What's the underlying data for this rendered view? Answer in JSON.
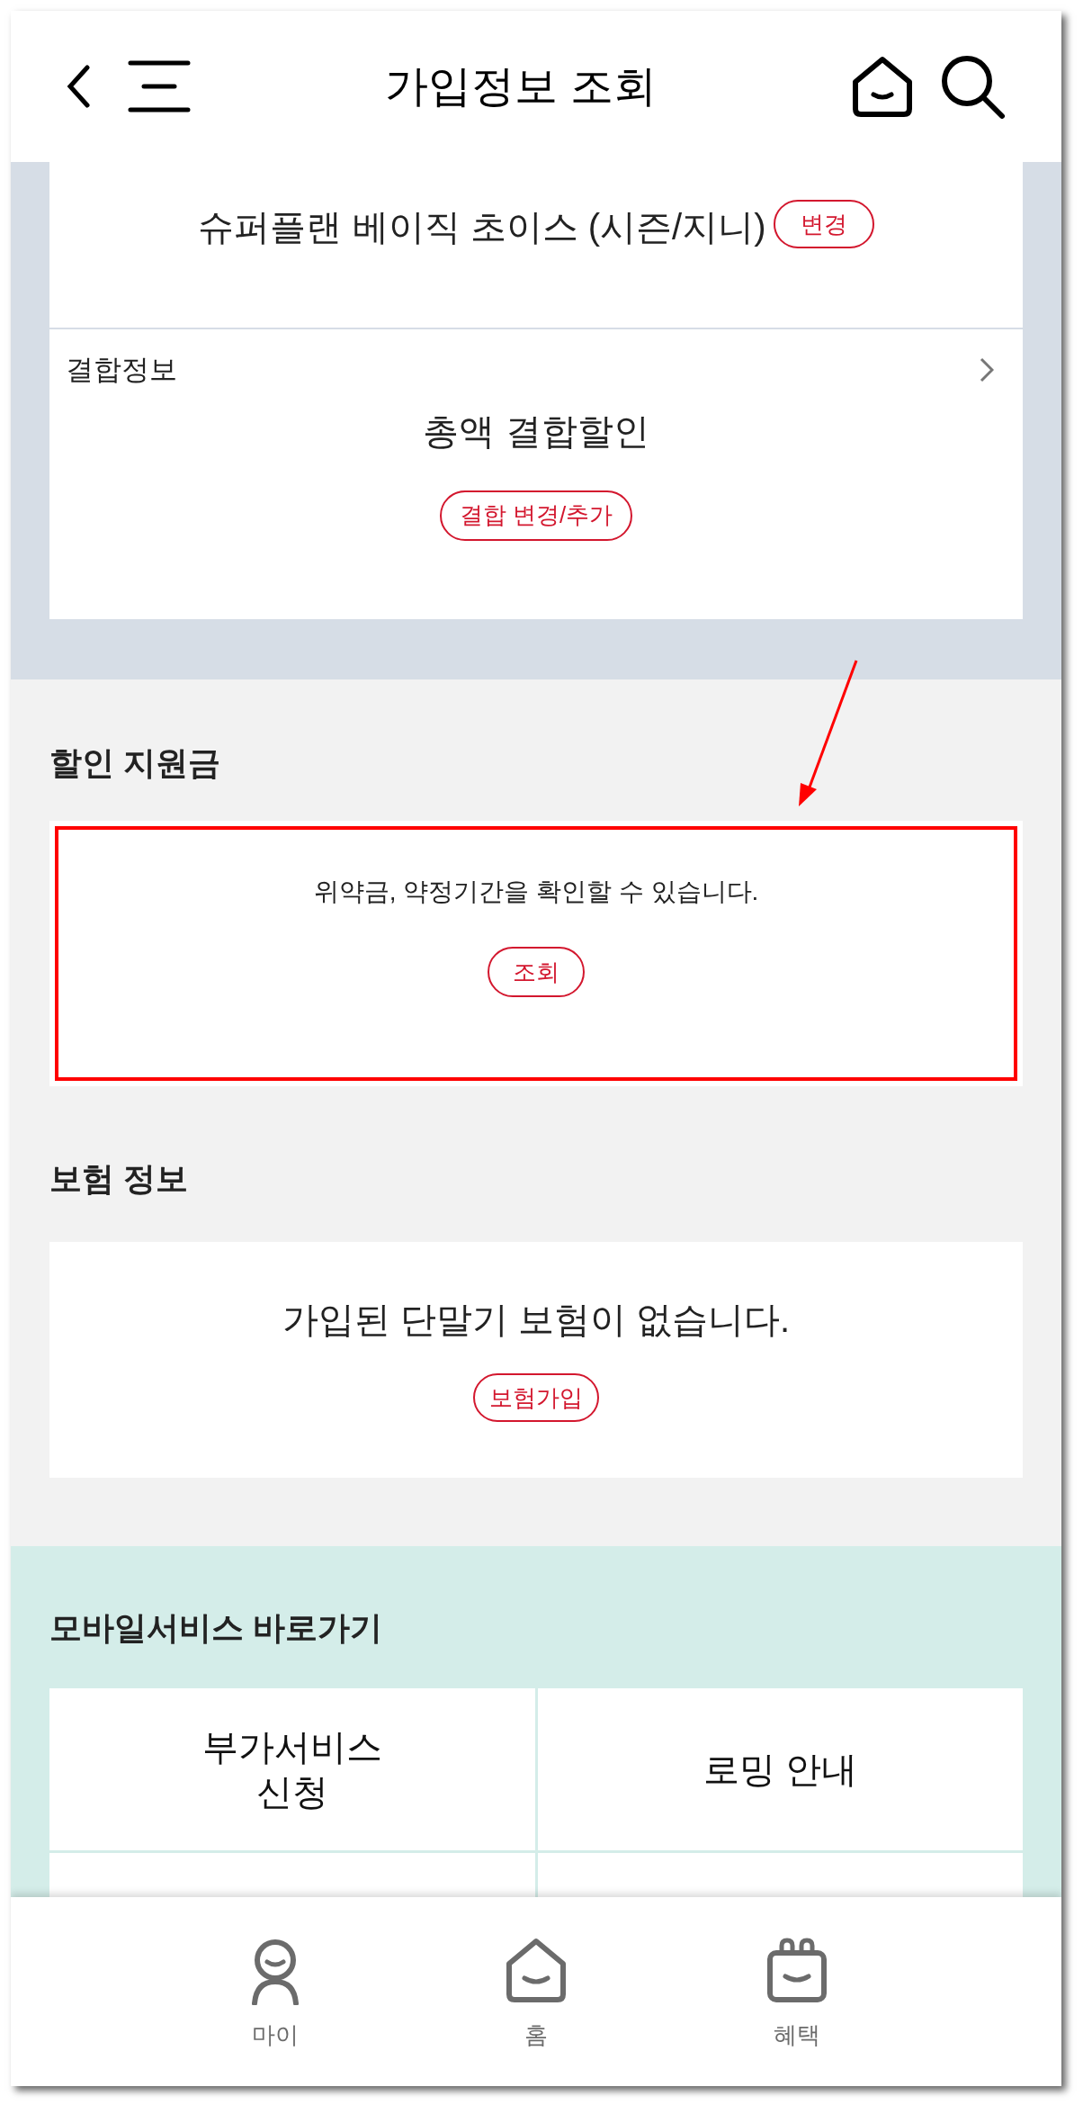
{
  "header": {
    "title": "가입정보 조회"
  },
  "plan": {
    "name": "슈퍼플랜 베이직 초이스 (시즌/지니)",
    "button": "변경"
  },
  "combination": {
    "label": "결합정보",
    "value": "총액 결합할인",
    "button": "결합 변경/추가"
  },
  "discount": {
    "heading": "할인 지원금",
    "message": "위약금, 약정기간을 확인할 수 있습니다.",
    "button": "조회",
    "highlighted": true
  },
  "insurance": {
    "heading": "보험 정보",
    "message": "가입된 단말기 보험이 없습니다.",
    "button": "보험가입"
  },
  "shortcuts": {
    "heading": "모바일서비스 바로가기",
    "items": [
      {
        "label": "부가서비스\n신청"
      },
      {
        "label": "로밍 안내"
      }
    ]
  },
  "bottom_nav": [
    {
      "label": "마이"
    },
    {
      "label": "홈"
    },
    {
      "label": "혜택"
    }
  ]
}
